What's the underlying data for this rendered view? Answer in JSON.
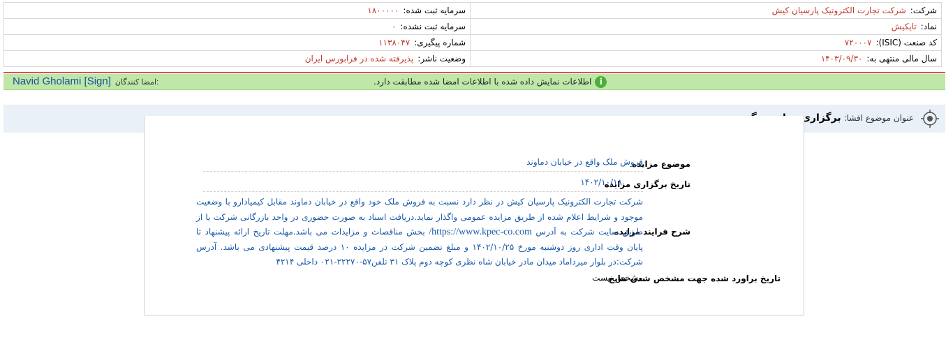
{
  "header": {
    "company_label": "شرکت:",
    "company_value": "شرکت تجارت الکترونیک پارسیان کیش",
    "registered_capital_label": "سرمایه ثبت شده:",
    "registered_capital_value": "۱۸۰۰۰۰۰",
    "symbol_label": "نماد:",
    "symbol_value": "تاپکیش",
    "unregistered_capital_label": "سرمایه ثبت نشده:",
    "unregistered_capital_value": "۰",
    "isic_label": "کد صنعت (ISIC):",
    "isic_value": "۷۲۰۰۰۷",
    "tracking_label": "شماره پیگیری:",
    "tracking_value": "۱۱۳۸۰۴۷",
    "fiscal_year_label": "سال مالی منتهی به:",
    "fiscal_year_value": "۱۴۰۳/۰۹/۳۰",
    "publisher_status_label": "وضعیت ناشر:",
    "publisher_status_value": "پذیرفته شده در فرابورس ایران"
  },
  "verification": {
    "signers_label": "امضا کنندگان:",
    "signer_name": "Navid Gholami [Sign]",
    "message": "اطلاعات نمایش داده شده با اطلاعات امضا شده مطابقت دارد.",
    "icon": "check-circle-icon",
    "icon_glyph": "i"
  },
  "subject": {
    "label": "عنوان موضوع افشا:",
    "value": "برگزاری مزایده - گروه ب",
    "icon": "target-icon"
  },
  "details": {
    "topic_label": "موضوع مزایده",
    "topic_value": "فروش ملک واقع در خیابان دماوند",
    "date_label": "تاریخ برگزاری مزایده",
    "date_value": "۱۴۰۲/۱۰/۱۸",
    "process_label": "شرح فرایند مزایده",
    "process_text_1": "شرکت تجارت الکترونیک پارسیان کیش در نظر دارد نسبت به فروش ملک خود واقع در خیابان دماوند مقابل کیمیادارو با وضعیت موجود و شرایط اعلام شده از طریق مزایده عمومی واگذار نماید.دریافت اسناد به صورت حضوری در واحد بازرگانی شرکت یا از طریق سایت شرکت به آدرس",
    "process_link": "https://www.kpec-co.com/",
    "process_text_2": "بخش مناقصات و مزایدات می باشد.مهلت تاریخ ارائه پیشنهاد تا پایان وقت اداری روز دوشنبه مورخ ۱۴۰۲/۱۰/۲۵ و مبلغ تضمین شرکت در مزایده ۱۰ درصد قیمت پیشنهادی می باشد. آدرس شرکت:در بلوار میرداماد میدان مادر خیابان شاه نظری کوچه دوم پلاک ۳۱ تلفن۵۷-۲۲۲۷۰-۰۲۱ داخلی ۴۲۱۴",
    "results_label": "تاریخ براورد شده جهت مشخص شدن نتایج",
    "results_value": "مشخص نیست"
  }
}
